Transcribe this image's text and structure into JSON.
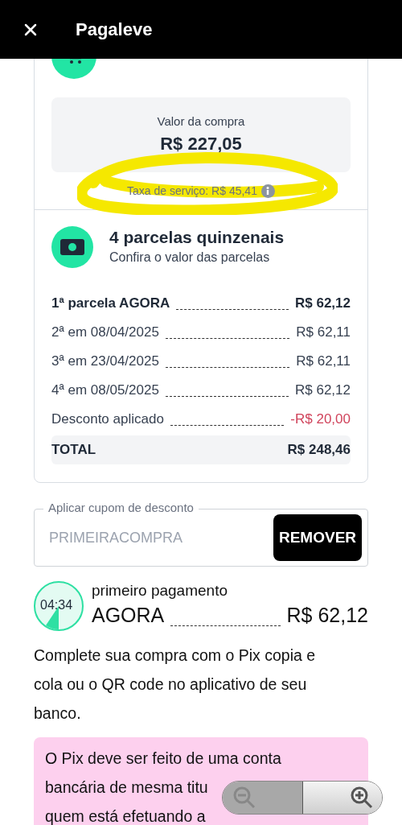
{
  "header": {
    "title": "Pagaleve"
  },
  "purchase": {
    "label": "Valor da compra",
    "amount": "R$ 227,05",
    "fee": "Taxa de serviço: R$ 45,41"
  },
  "installments": {
    "title": "4 parcelas quinzenais",
    "subtitle": "Confira o valor das parcelas",
    "rows": [
      {
        "kind": "first",
        "label": "1ª parcela AGORA",
        "amount": "R$ 62,12"
      },
      {
        "kind": "regular",
        "label": "2ª em 08/04/2025",
        "amount": "R$ 62,11"
      },
      {
        "kind": "regular",
        "label": "3ª em 23/04/2025",
        "amount": "R$ 62,11"
      },
      {
        "kind": "regular",
        "label": "4ª em 08/05/2025",
        "amount": "R$ 62,12"
      },
      {
        "kind": "discount",
        "label": "Desconto aplicado",
        "amount": "-R$ 20,00"
      }
    ],
    "total": {
      "label": "TOTAL",
      "amount": "R$ 248,46"
    }
  },
  "coupon": {
    "label": "Aplicar cupom de desconto",
    "value": "PRIMEIRACOMPRA",
    "button": "REMOVER"
  },
  "first_payment": {
    "timer": "04:34",
    "label": "primeiro pagamento",
    "when": "AGORA",
    "amount": "R$ 62,12"
  },
  "instructions": "Complete sua compra com o Pix copia e cola ou o QR code no aplicativo de seu banco.",
  "warning_lines": [
    "O Pix deve ser feito de uma conta",
    "bancária de mesma titu",
    "quem está efetuando a"
  ]
}
